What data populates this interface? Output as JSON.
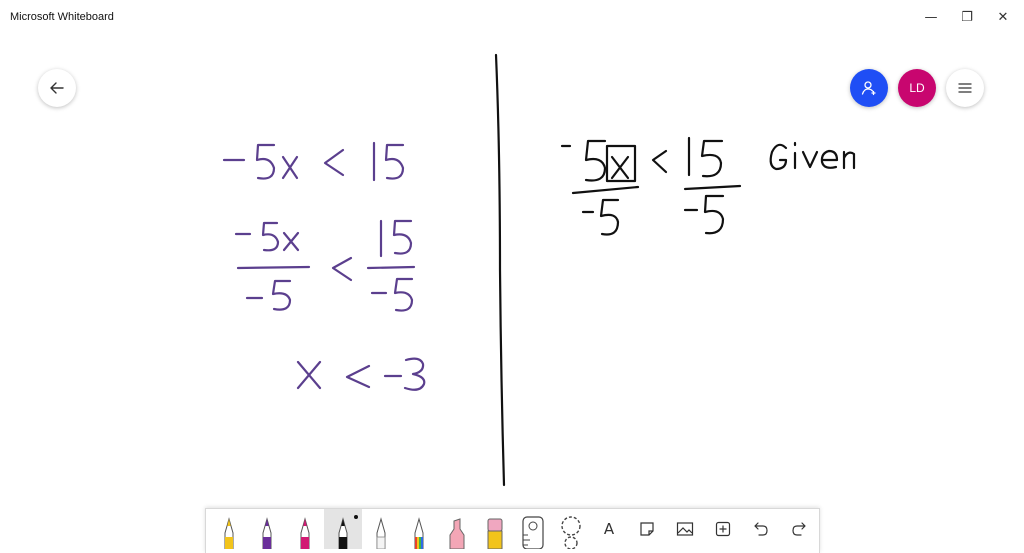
{
  "window": {
    "title": "Microsoft Whiteboard",
    "minimize_glyph": "—",
    "restore_glyph": "❐",
    "close_glyph": "✕"
  },
  "header": {
    "back_icon": "arrow-left-icon",
    "share_icon": "person-icon",
    "avatar_initials": "LD",
    "menu_icon": "hamburger-icon"
  },
  "colors": {
    "share_button": "#1f4ef5",
    "avatar": "#c8066f",
    "ink_purple": "#5b3f8e",
    "ink_black": "#111111"
  },
  "board": {
    "left_work": [
      "−5x < 15",
      "−5x / −5 < 15 / −5",
      "x < −3"
    ],
    "right_work": [
      "−5x / −5 < 15 / −5",
      "Given"
    ]
  },
  "toolbar": {
    "tools": [
      {
        "name": "yellow-pen",
        "color": "#f2c41b"
      },
      {
        "name": "purple-pen",
        "color": "#6a2f9a"
      },
      {
        "name": "pink-pen",
        "color": "#d11b73"
      },
      {
        "name": "black-pen",
        "color": "#111111",
        "selected": true
      },
      {
        "name": "white-pen",
        "color": "#eeeeee"
      },
      {
        "name": "rainbow-pen",
        "color": "#e8412c"
      },
      {
        "name": "highlighter",
        "color": "#f3a6b6"
      },
      {
        "name": "eraser",
        "color": "#f0a7c0"
      },
      {
        "name": "ruler",
        "color": "#666666"
      },
      {
        "name": "lasso",
        "color": "#666666"
      }
    ],
    "text_tool_glyph": "A",
    "actions": [
      "note-icon",
      "image-icon",
      "add-icon",
      "undo-icon",
      "redo-icon"
    ]
  }
}
